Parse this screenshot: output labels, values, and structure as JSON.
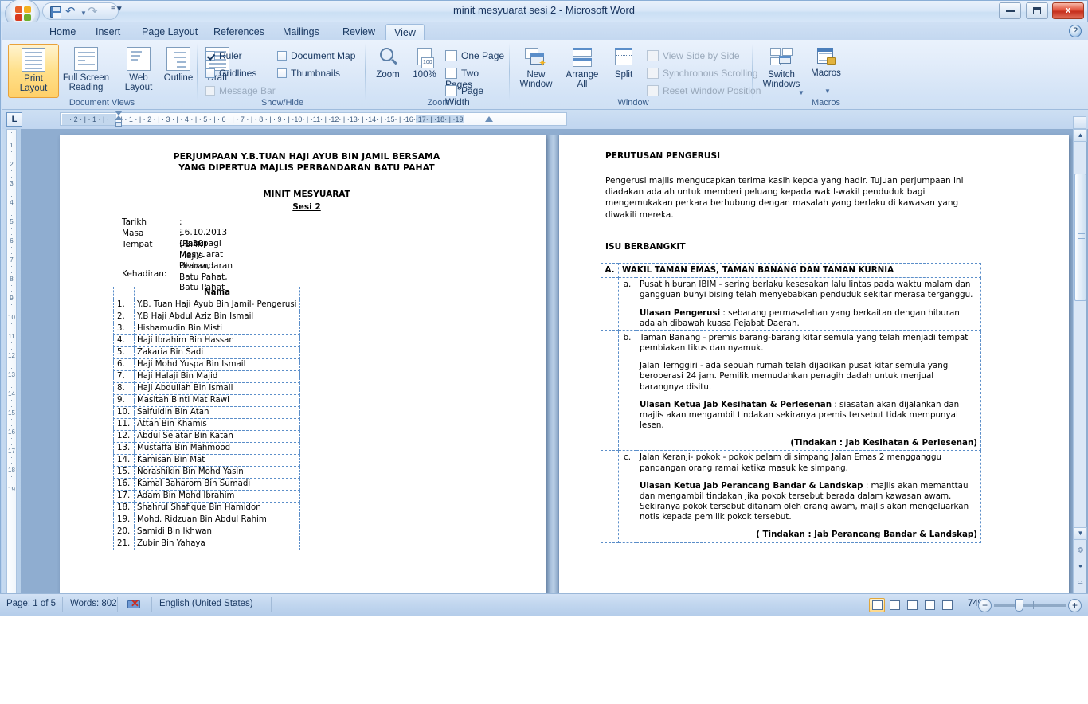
{
  "window": {
    "title": "minit mesyuarat sesi 2 - Microsoft Word",
    "minimize_label": "",
    "maximize_label": "",
    "close_label": "x",
    "help_label": "?"
  },
  "quick_access": {
    "save": "save-icon",
    "undo": "undo-icon",
    "redo": "redo-icon",
    "customize": "customize-icon"
  },
  "tabs": [
    {
      "label": "Home",
      "active": false
    },
    {
      "label": "Insert",
      "active": false
    },
    {
      "label": "Page Layout",
      "active": false
    },
    {
      "label": "References",
      "active": false
    },
    {
      "label": "Mailings",
      "active": false
    },
    {
      "label": "Review",
      "active": false
    },
    {
      "label": "View",
      "active": true
    }
  ],
  "ribbon": {
    "groups": [
      {
        "name": "Document Views"
      },
      {
        "name": "Show/Hide"
      },
      {
        "name": "Zoom"
      },
      {
        "name": "Window"
      },
      {
        "name": "Macros"
      }
    ],
    "document_views": [
      {
        "label_line1": "Print",
        "label_line2": "Layout",
        "selected": true
      },
      {
        "label_line1": "Full Screen",
        "label_line2": "Reading",
        "selected": false
      },
      {
        "label_line1": "Web",
        "label_line2": "Layout",
        "selected": false
      },
      {
        "label_line1": "Outline",
        "label_line2": "",
        "selected": false
      },
      {
        "label_line1": "Draft",
        "label_line2": "",
        "selected": false
      }
    ],
    "show_hide": [
      {
        "label": "Ruler",
        "checked": true,
        "enabled": true
      },
      {
        "label": "Gridlines",
        "checked": false,
        "enabled": true
      },
      {
        "label": "Message Bar",
        "checked": false,
        "enabled": false
      },
      {
        "label": "Document Map",
        "checked": false,
        "enabled": true
      },
      {
        "label": "Thumbnails",
        "checked": false,
        "enabled": true
      }
    ],
    "zoom": {
      "zoom_label": "Zoom",
      "percent_label": "100%",
      "one_page": "One Page",
      "two_pages": "Two Pages",
      "page_width": "Page Width"
    },
    "window": {
      "new_window_line1": "New",
      "new_window_line2": "Window",
      "arrange_all_line1": "Arrange",
      "arrange_all_line2": "All",
      "split": "Split",
      "view_side_by_side": "View Side by Side",
      "synchronous_scrolling": "Synchronous Scrolling",
      "reset_window_position": "Reset Window Position",
      "switch_windows_line1": "Switch",
      "switch_windows_line2": "Windows"
    },
    "macros": {
      "label": "Macros"
    }
  },
  "ruler": {
    "tab_selector": "L",
    "horizontal_ticks": "·  2  ·  |  ·  1  ·  |  ·",
    "horizontal_ticks_right": "·  |  ·  1  ·  |  ·  2  ·  |  ·  3  ·  |  ·  4  ·  |  ·  5  ·  |  ·  6  ·  |  ·  7  ·  |  ·  8  ·  |  ·  9  ·  |  ·10·  |  ·11·  |  ·12·  |  ·13·  |  ·14·  |  ·15·  |  ·16·",
    "horizontal_ticks_tail": "·17·  |  ·18·  |  ·19",
    "vertical_ticks": [
      "·",
      "·",
      "1",
      "·",
      "·",
      "2",
      "·",
      "·",
      "3",
      "·",
      "·",
      "4",
      "·",
      "·",
      "5",
      "·",
      "·",
      "6",
      "·",
      "·",
      "7",
      "·",
      "·",
      "8",
      "·",
      "·",
      "9",
      "·",
      "·",
      "10",
      "·",
      "·",
      "11",
      "·",
      "·",
      "12",
      "·",
      "·",
      "13",
      "·",
      "·",
      "14",
      "·",
      "·",
      "15",
      "·",
      "·",
      "16",
      "·",
      "·",
      "17",
      "·",
      "·",
      "18",
      "·",
      "·",
      "19",
      "·",
      "·"
    ]
  },
  "document": {
    "left_page": {
      "title_line1": "PERJUMPAAN Y.B.TUAN HAJI AYUB BIN JAMIL  BERSAMA",
      "title_line2": "YANG DIPERTUA MAJLIS PERBANDARAN BATU PAHAT",
      "subtitle1": "MINIT MESYUARAT",
      "subtitle2": "Sesi 2",
      "meta": [
        {
          "label": "Tarikh",
          "value": ": 16.10.2013 (Rabu)"
        },
        {
          "label": "Masa",
          "value": ": 11.30pagi"
        },
        {
          "label": "Tempat",
          "value": ": Bilik Mesyuarat Utama,"
        },
        {
          "label": "",
          "value": "  Majlis Perbandaran Batu Pahat, Batu Pahat"
        }
      ],
      "attendance_label": "Kehadiran:",
      "table_header": "Nama",
      "attendees": [
        {
          "no": "1.",
          "name": "Y.B. Tuan Haji Ayub Bin Jamil- Pengerusi"
        },
        {
          "no": "2.",
          "name": "Y.B Haji Abdul Aziz Bin Ismail"
        },
        {
          "no": "3.",
          "name": "Hishamudin Bin Misti"
        },
        {
          "no": "4.",
          "name": "Haji Ibrahim Bin Hassan"
        },
        {
          "no": "5.",
          "name": "Zakaria Bin Sadi"
        },
        {
          "no": "6.",
          "name": "Haji Mohd Yuspa Bin Ismail"
        },
        {
          "no": "7.",
          "name": "Haji Halaji Bin Majid"
        },
        {
          "no": "8.",
          "name": "Haji Abdullah Bin Ismail"
        },
        {
          "no": "9.",
          "name": "Masitah Binti Mat Rawi"
        },
        {
          "no": "10.",
          "name": "Saifuldin Bin Atan"
        },
        {
          "no": "11.",
          "name": "Attan Bin Khamis"
        },
        {
          "no": "12.",
          "name": "Abdul Selatar Bin Katan"
        },
        {
          "no": "13.",
          "name": "Mustaffa Bin Mahmood"
        },
        {
          "no": "14.",
          "name": "Kamisan Bin Mat"
        },
        {
          "no": "15.",
          "name": "Norashikin Bin Mohd Yasin"
        },
        {
          "no": "16.",
          "name": "Kamal Baharom Bin Sumadi"
        },
        {
          "no": "17.",
          "name": "Adam Bin Mohd Ibrahim"
        },
        {
          "no": "18.",
          "name": "Shahrul Shafique Bin Hamidon"
        },
        {
          "no": "19.",
          "name": "Mohd. Ridzuan Bin Abdul Rahim"
        },
        {
          "no": "20.",
          "name": "Samidi Bin Ikhwan"
        },
        {
          "no": "21.",
          "name": "Zubir Bin Yahaya"
        }
      ]
    },
    "right_page": {
      "heading1": "PERUTUSAN PENGERUSI",
      "para1": "Pengerusi majlis mengucapkan terima kasih kepda yang hadir.  Tujuan perjumpaan ini diadakan adalah untuk memberi peluang kepada wakil-wakil penduduk bagi mengemukakan perkara berhubung dengan masalah yang berlaku di kawasan yang diwakili mereka.",
      "heading2": "ISU BERBANGKIT",
      "section_letter": "A.",
      "section_title": "WAKIL TAMAN EMAS, TAMAN BANANG DAN TAMAN KURNIA",
      "items": [
        {
          "letter": "a.",
          "blocks": [
            {
              "bold_lead": "",
              "text": "Pusat hiburan IBIM - sering berlaku kesesakan lalu lintas pada waktu malam dan gangguan bunyi bising telah menyebabkan penduduk sekitar merasa terganggu."
            },
            {
              "bold_lead": "Ulasan Pengerusi",
              "text": " : sebarang permasalahan yang berkaitan dengan hiburan adalah dibawah kuasa Pejabat Daerah."
            }
          ],
          "action": ""
        },
        {
          "letter": "b.",
          "blocks": [
            {
              "bold_lead": "",
              "text": "Taman Banang - premis barang-barang kitar semula yang telah menjadi tempat pembiakan tikus dan nyamuk."
            },
            {
              "bold_lead": "",
              "text": "Jalan Ternggiri - ada sebuah rumah telah dijadikan pusat kitar semula yang beroperasi 24 jam. Pemilik memudahkan penagih dadah untuk menjual barangnya disitu."
            },
            {
              "bold_lead": "Ulasan Ketua Jab Kesihatan & Perlesenan",
              "text": " : siasatan akan dijalankan dan majlis akan mengambil tindakan sekiranya premis tersebut tidak mempunyai lesen."
            }
          ],
          "action": "(Tindakan : Jab Kesihatan & Perlesenan)"
        },
        {
          "letter": "c.",
          "blocks": [
            {
              "bold_lead": "",
              "text": "Jalan Keranji-  pokok - pokok pelam di simpang Jalan Emas 2 mengganggu pandangan orang ramai ketika masuk ke simpang."
            },
            {
              "bold_lead": "Ulasan Ketua Jab Perancang Bandar & Landskap",
              "text": " : majlis akan memanttau dan mengambil tindakan jika pokok tersebut berada dalam kawasan awam. Sekiranya pokok tersebut ditanam oleh orang awam, majlis akan mengeluarkan notis kepada pemilik pokok tersebut."
            }
          ],
          "action": "( Tindakan : Jab Perancang Bandar & Landskap)"
        }
      ]
    }
  },
  "status_bar": {
    "page": "Page: 1 of 5",
    "words": "Words: 802",
    "proofing_icon": "proofing-errors-icon",
    "language": "English (United States)",
    "zoom_percent": "74%",
    "zoom_out": "−",
    "zoom_in": "+",
    "view_buttons": [
      {
        "name": "print-layout-view",
        "active": true
      },
      {
        "name": "full-screen-reading-view",
        "active": false
      },
      {
        "name": "web-layout-view",
        "active": false
      },
      {
        "name": "outline-view",
        "active": false
      },
      {
        "name": "draft-view",
        "active": false
      }
    ]
  },
  "colors": {
    "accent": "#1b3a63",
    "selected_orange": "#ffd06a",
    "spell_error": "#e00000",
    "grammar_error": "#0a8a0a",
    "table_grid": "#5b8ec9"
  }
}
